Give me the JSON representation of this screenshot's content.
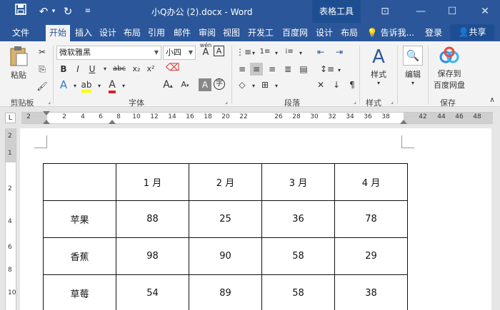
{
  "titlebar": {
    "doc_title": "小Q办公 (2).docx - Word",
    "table_tools": "表格工具"
  },
  "tabs": [
    "文件",
    "开始",
    "插入",
    "设计",
    "布局",
    "引用",
    "邮件",
    "审阅",
    "视图",
    "开发工",
    "百度网",
    "设计",
    "布局"
  ],
  "tell_me": "告诉我...",
  "login": "登录",
  "share": "共享",
  "ribbon": {
    "paste": "粘贴",
    "clipboard": "剪贴板",
    "font_name": "微软雅黑",
    "font_size": "小四",
    "wen_label": "wén",
    "wen_char": "A",
    "font_group": "字体",
    "paragraph_group": "段落",
    "styles": "样式",
    "styles_group": "样式",
    "edit": "编辑",
    "save_baidu_line1": "保存到",
    "save_baidu_line2": "百度网盘",
    "save_group": "保存"
  },
  "ruler": {
    "numbers": [
      "2",
      "2",
      "4",
      "6",
      "8",
      "10",
      "12",
      "14",
      "16",
      "18",
      "20",
      "22",
      "26",
      "28",
      "30",
      "32",
      "34",
      "36",
      "38",
      "42",
      "44",
      "46",
      "48"
    ],
    "corner": "L"
  },
  "vruler": [
    "2",
    "1",
    "2",
    "4",
    "6",
    "8",
    "10"
  ],
  "table": {
    "header": [
      "",
      "1 月",
      "2 月",
      "3 月",
      "4 月"
    ],
    "rows": [
      [
        "苹果",
        "88",
        "25",
        "36",
        "78"
      ],
      [
        "香蕉",
        "98",
        "90",
        "58",
        "29"
      ],
      [
        "草莓",
        "54",
        "89",
        "58",
        "38"
      ]
    ]
  }
}
